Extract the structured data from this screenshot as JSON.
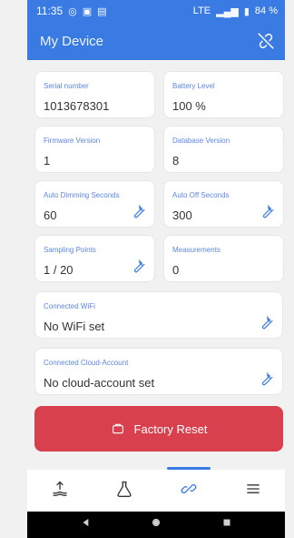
{
  "status": {
    "time": "11:35",
    "network": "LTE",
    "battery": "84 %"
  },
  "app": {
    "title": "My Device",
    "unlink_icon": "unlink-icon"
  },
  "cards": {
    "serial": {
      "label": "Serial number",
      "value": "1013678301"
    },
    "battery": {
      "label": "Battery Level",
      "value": "100 %"
    },
    "firmware": {
      "label": "Firmware Version",
      "value": "1"
    },
    "database": {
      "label": "Database Version",
      "value": "8"
    },
    "auto_dimming": {
      "label": "Auto Dimming Seconds",
      "value": "60",
      "icon": "wrench-icon"
    },
    "auto_off": {
      "label": "Auto Off Seconds",
      "value": "300",
      "icon": "wrench-icon"
    },
    "sampling": {
      "label": "Sampling Points",
      "value": "1 / 20",
      "icon": "wrench-icon"
    },
    "measurements": {
      "label": "Measurements",
      "value": "0"
    },
    "wifi": {
      "label": "Connected WiFi",
      "value": "No WiFi set",
      "icon": "wrench-icon"
    },
    "cloud": {
      "label": "Connected Cloud-Account",
      "value": "No cloud-account set",
      "icon": "wrench-icon"
    }
  },
  "actions": {
    "factory_reset": "Factory Reset"
  },
  "nav": {
    "items": [
      "upload-icon",
      "flask-icon",
      "link-icon",
      "menu-icon"
    ],
    "active_index": 2
  },
  "colors": {
    "primary": "#3a7be3",
    "danger": "#d9404e",
    "label": "#5c86e6"
  }
}
